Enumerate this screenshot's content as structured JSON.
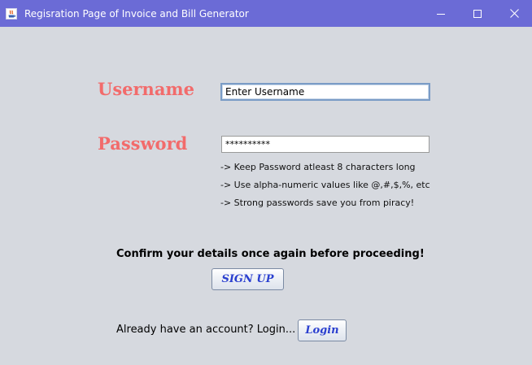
{
  "window": {
    "title": "Regisration Page of Invoice and Bill Generator",
    "icon": "java-app-icon",
    "controls": {
      "minimize_icon": "minimize-icon",
      "maximize_icon": "maximize-icon",
      "close_icon": "close-icon"
    },
    "titlebar_color": "#6b6bd6",
    "background_color": "#d6d9df"
  },
  "form": {
    "username_label": "Username",
    "username_value": "Enter Username",
    "password_label": "Password",
    "password_value": "**********",
    "label_color": "#f26b6b",
    "hints": [
      "-> Keep Password atleast 8 characters long",
      "-> Use alpha-numeric values like @,#,$,%, etc",
      "-> Strong passwords save you from piracy!"
    ],
    "confirm_text": "Confirm your details once again before proceeding!",
    "signup_label": "SIGN UP",
    "already_text": "Already have an account? Login...",
    "login_label": "Login",
    "button_text_color": "#2a3fcf"
  }
}
